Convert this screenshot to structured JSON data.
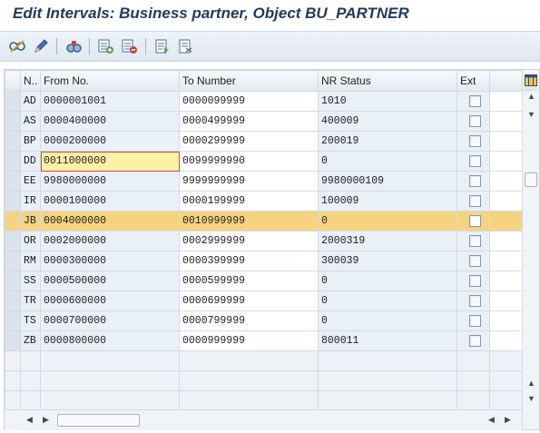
{
  "window": {
    "title": "Edit Intervals: Business partner, Object BU_PARTNER"
  },
  "toolbar": {
    "buttons": [
      "display-change-icon",
      "pencil-icon",
      "search-binocular-icon",
      "insert-interval-icon",
      "delete-interval-icon",
      "export-icon",
      "print-icon"
    ]
  },
  "table": {
    "headers": {
      "key": "N..",
      "from": "From No.",
      "to": "To Number",
      "nr_status": "NR Status",
      "ext": "Ext"
    },
    "rows": [
      {
        "key": "AD",
        "from": "0000001001",
        "to": "0000099999",
        "nr_status": "1010"
      },
      {
        "key": "AS",
        "from": "0000400000",
        "to": "0000499999",
        "nr_status": "400009"
      },
      {
        "key": "BP",
        "from": "0000200000",
        "to": "0000299999",
        "nr_status": "200019"
      },
      {
        "key": "DD",
        "from": "0011000000",
        "to": "0099999990",
        "nr_status": "0"
      },
      {
        "key": "EE",
        "from": "9980000000",
        "to": "9999999999",
        "nr_status": "9980000109"
      },
      {
        "key": "IR",
        "from": "0000100000",
        "to": "0000199999",
        "nr_status": "100009"
      },
      {
        "key": "JB",
        "from": "0004000000",
        "to": "0010999999",
        "nr_status": "0"
      },
      {
        "key": "OR",
        "from": "0002000000",
        "to": "0002999999",
        "nr_status": "2000319"
      },
      {
        "key": "RM",
        "from": "0000300000",
        "to": "0000399999",
        "nr_status": "300039"
      },
      {
        "key": "SS",
        "from": "0000500000",
        "to": "0000599999",
        "nr_status": "0"
      },
      {
        "key": "TR",
        "from": "0000600000",
        "to": "0000699999",
        "nr_status": "0"
      },
      {
        "key": "TS",
        "from": "0000700000",
        "to": "0000799999",
        "nr_status": "0"
      },
      {
        "key": "ZB",
        "from": "0000800000",
        "to": "0000999999",
        "nr_status": "800011"
      }
    ]
  },
  "colors": {
    "title": "#1f3a5f",
    "highlight_row": "#f6d47f",
    "edit_cell": "#fdf1a6",
    "edit_border": "#e04040"
  }
}
